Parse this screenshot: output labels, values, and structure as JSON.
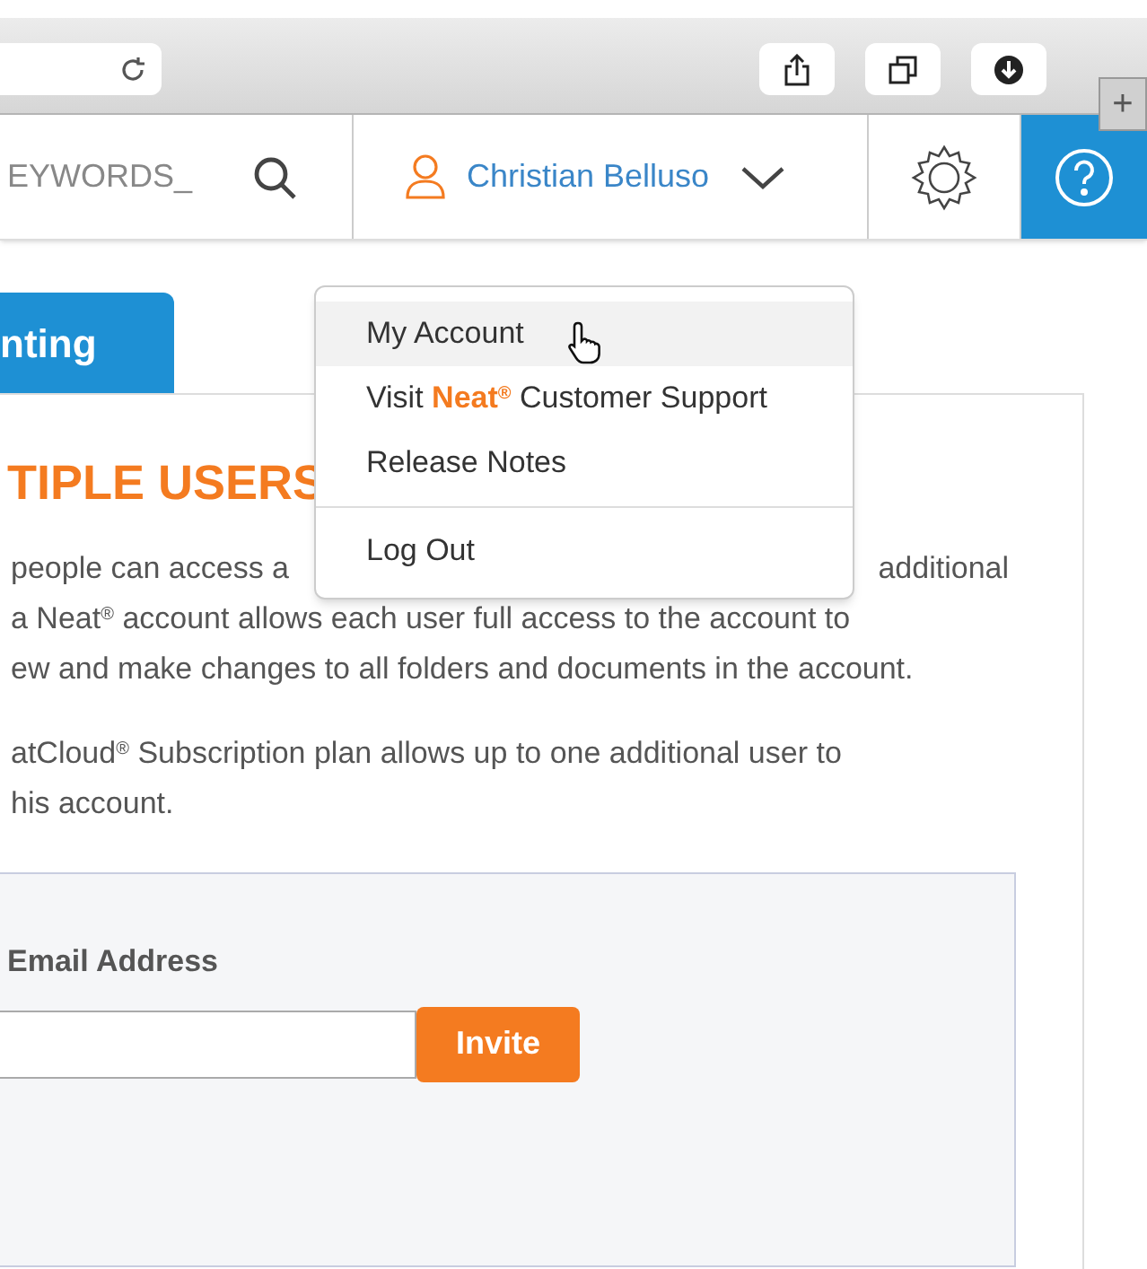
{
  "browser": {
    "new_tab": "+"
  },
  "nav": {
    "search_placeholder": "EYWORDS_",
    "user_name": "Christian Belluso"
  },
  "tab": {
    "label": "nting",
    "selected": true
  },
  "heading": "TIPLE USERS",
  "paragraphs": [
    {
      "lines": [
        [
          "people can access a",
          "additional"
        ],
        [
          "a Neat$^{®}$ account allows each user full access to the account to"
        ],
        [
          "ew and make changes to all folders and documents in the account."
        ]
      ]
    },
    {
      "lines": [
        [
          "atCloud$^{®}$ Subscription plan allows up to one additional user to"
        ],
        [
          "his account."
        ]
      ]
    }
  ],
  "menu": {
    "groups": [
      [
        {
          "label": "My Account",
          "highlighted": true
        },
        {
          "label": "Visit **Neat**$^{®}$ Customer Support",
          "highlighted": false
        },
        {
          "label": "Release Notes",
          "highlighted": false
        }
      ],
      [
        {
          "label": "Log Out",
          "highlighted": false
        }
      ]
    ]
  },
  "invite": {
    "label": "Email Address",
    "button": "Invite"
  }
}
